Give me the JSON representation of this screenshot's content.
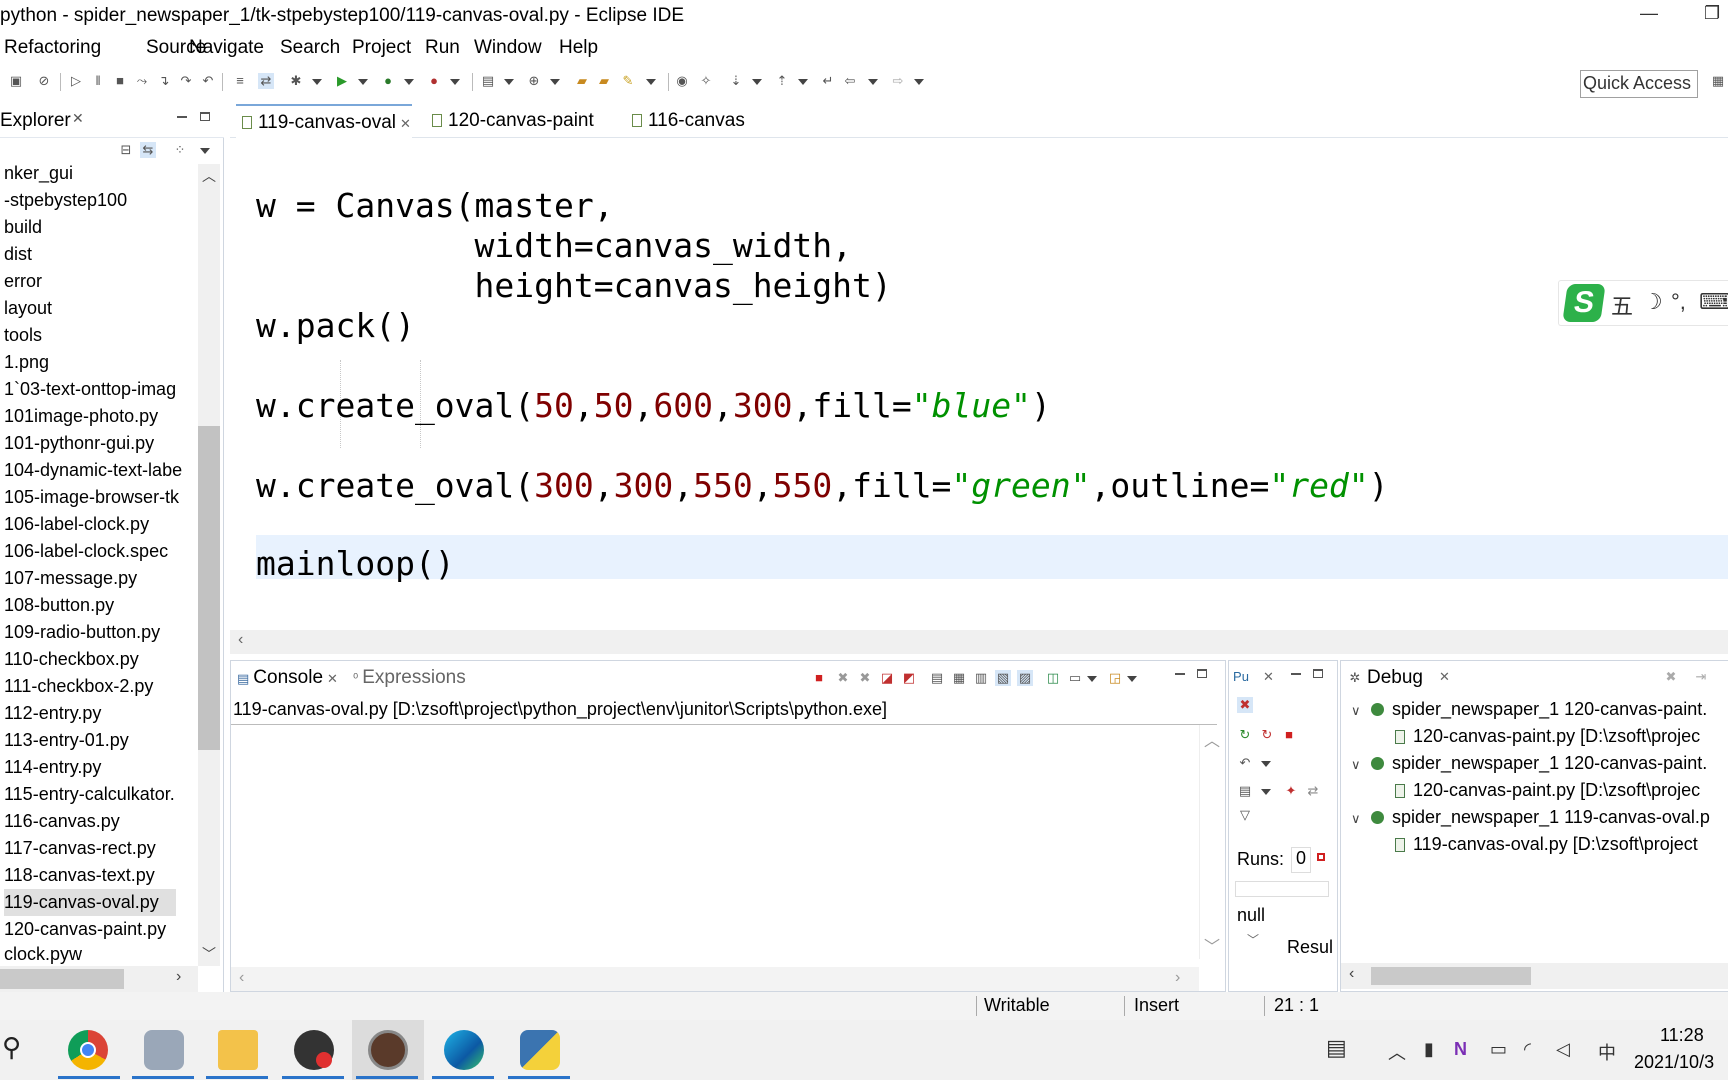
{
  "window": {
    "title": "python - spider_newspaper_1/tk-stpebystep100/119-canvas-oval.py - Eclipse IDE"
  },
  "menu": [
    "Refactoring",
    "Source",
    "Navigate",
    "Search",
    "Project",
    "Run",
    "Window",
    "Help"
  ],
  "toolbar": {
    "quick_access": "Quick Access"
  },
  "explorer": {
    "title": "Explorer",
    "items": [
      "nker_gui",
      "-stpebystep100",
      "build",
      "dist",
      "error",
      "layout",
      "tools",
      "1.png",
      "1`03-text-onttop-imag",
      "101image-photo.py",
      "101-pythonr-gui.py",
      "104-dynamic-text-labe",
      "105-image-browser-tk",
      "106-label-clock.py",
      "106-label-clock.spec",
      "107-message.py",
      "108-button.py",
      "109-radio-button.py",
      "110-checkbox.py",
      "111-checkbox-2.py",
      "112-entry.py",
      "113-entry-01.py",
      "114-entry.py",
      "115-entry-calculkator.",
      "116-canvas.py",
      "117-canvas-rect.py",
      "118-canvas-text.py",
      "119-canvas-oval.py",
      "120-canvas-paint.py",
      "clock.pyw"
    ],
    "selected_item": "119-canvas-oval.py"
  },
  "editor": {
    "tabs": [
      "119-canvas-oval",
      "120-canvas-paint",
      "116-canvas"
    ],
    "active_tab": "119-canvas-oval",
    "code": {
      "line1": "w = Canvas(master,",
      "line2": "           width=canvas_width,",
      "line3": "           height=canvas_height)",
      "line4": "w.pack()",
      "oval1_pre": "w.create_oval(",
      "oval1_args": [
        "50",
        "50",
        "600",
        "300"
      ],
      "oval1_fill_kw": ",fill=",
      "oval1_fill_val": "\"blue\"",
      "oval1_close": ")",
      "oval2_pre": "w.create_oval(",
      "oval2_args": [
        "300",
        "300",
        "550",
        "550"
      ],
      "oval2_fill_kw": ",fill=",
      "oval2_fill_val": "\"green\"",
      "oval2_outline_kw": ",outline=",
      "oval2_outline_val": "\"red\"",
      "oval2_close": ")",
      "line_last": "mainloop()"
    }
  },
  "ime": {
    "items": [
      "五",
      "☽",
      "°,",
      "⌨"
    ]
  },
  "console": {
    "tab_console": "Console",
    "tab_expressions": "Expressions",
    "path": "119-canvas-oval.py [D:\\zsoft\\project\\python_project\\env\\junitor\\Scripts\\python.exe]"
  },
  "junit": {
    "runs_label": "Runs:",
    "runs_value": "0",
    "null_text": "null",
    "result_label": "Resul"
  },
  "debug": {
    "title": "Debug",
    "launches": [
      {
        "label": "spider_newspaper_1 120-canvas-paint.",
        "child": "120-canvas-paint.py [D:\\zsoft\\projec"
      },
      {
        "label": "spider_newspaper_1 120-canvas-paint.",
        "child": "120-canvas-paint.py [D:\\zsoft\\projec"
      },
      {
        "label": "spider_newspaper_1 119-canvas-oval.p",
        "child": "119-canvas-oval.py [D:\\zsoft\\project"
      }
    ]
  },
  "status": {
    "writable": "Writable",
    "insert": "Insert",
    "position": "21 : 1"
  },
  "taskbar": {
    "time": "11:28",
    "date": "2021/10/3",
    "ime_lang": "中"
  },
  "colors": {
    "number": "#7f0000",
    "string": "#009100",
    "current_line": "#e8f2fe",
    "selection": "#e0e0e0"
  }
}
